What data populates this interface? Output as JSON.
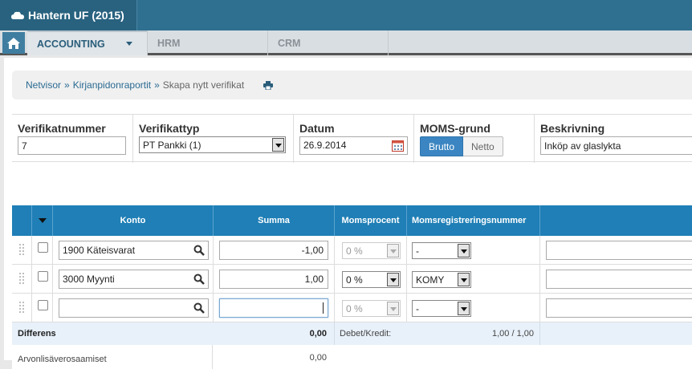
{
  "app": {
    "title": "Hantern UF (2015)"
  },
  "nav": {
    "items": [
      "ACCOUNTING",
      "HRM",
      "CRM"
    ]
  },
  "breadcrumb": {
    "items": [
      "Netvisor",
      "Kirjanpidonraportit"
    ],
    "current": "Skapa nytt verifikat",
    "separator": "»"
  },
  "form": {
    "verifikatnummer": {
      "label": "Verifikatnummer",
      "value": "7"
    },
    "verifikattyp": {
      "label": "Verifikattyp",
      "value": "PT Pankki (1)"
    },
    "datum": {
      "label": "Datum",
      "value": "26.9.2014"
    },
    "moms": {
      "label": "MOMS-grund",
      "options": [
        "Brutto",
        "Netto"
      ],
      "selected": "Brutto"
    },
    "beskrivning": {
      "label": "Beskrivning",
      "value": "Inköp av glaslykta"
    }
  },
  "grid": {
    "headers": [
      "Konto",
      "Summa",
      "Momsprocent",
      "Momsregistreringsnummer"
    ],
    "rows": [
      {
        "konto": "1900 Käteisvarat",
        "summa": "-1,00",
        "moms": "0 %",
        "reg": "-"
      },
      {
        "konto": "3000 Myynti",
        "summa": "1,00",
        "moms": "0 %",
        "reg": "KOMY"
      },
      {
        "konto": "",
        "summa": "",
        "moms": "0 %",
        "reg": "-"
      }
    ],
    "differens": {
      "label": "Differens",
      "value": "0,00",
      "dk_label": "Debet/Kredit:",
      "dk_value": "1,00 / 1,00"
    },
    "vat": {
      "label": "Arvonlisäverosaamiset",
      "value": "0,00"
    }
  },
  "colors": {
    "brand": "#2f6f8f",
    "grid_header": "#1f7fb6",
    "accent": "#3b86c2"
  }
}
